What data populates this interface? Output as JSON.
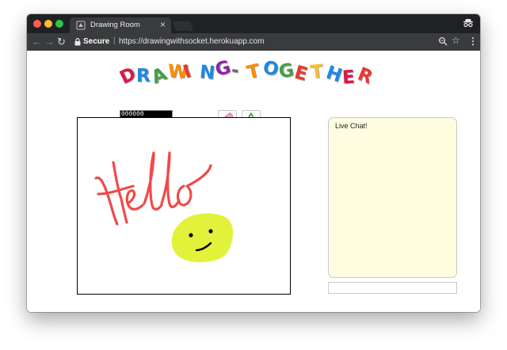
{
  "browser": {
    "tab_title": "Drawing Room",
    "tab_close": "×",
    "address_secure_label": "Secure",
    "address_separator": "|",
    "address_url": "https://drawingwithsocket.herokuapp.com",
    "back_glyph": "←",
    "forward_glyph": "→",
    "reload_glyph": "↻",
    "star_glyph": "☆",
    "menu_glyph": "⋮"
  },
  "page": {
    "logo_letters": [
      {
        "char": "D",
        "color": "#d81b4a"
      },
      {
        "char": "R",
        "color": "#1e88e5"
      },
      {
        "char": "A",
        "color": "#43a047"
      },
      {
        "char": "W",
        "color": "#fb8c00"
      },
      {
        "char": "I",
        "color": "#e53935"
      },
      {
        "char": "N",
        "color": "#1e88e5"
      },
      {
        "char": "G",
        "color": "#8e24aa"
      },
      {
        "char": "-",
        "color": "#6d6d6d"
      },
      {
        "char": "T",
        "color": "#fb8c00"
      },
      {
        "char": "O",
        "color": "#1e88e5"
      },
      {
        "char": "G",
        "color": "#43a047"
      },
      {
        "char": "E",
        "color": "#e53935"
      },
      {
        "char": "T",
        "color": "#fbc02d"
      },
      {
        "char": "H",
        "color": "#1e88e5"
      },
      {
        "char": "E",
        "color": "#d81b4a"
      },
      {
        "char": "R",
        "color": "#e53935"
      }
    ],
    "color_value": "000000",
    "brush_size_fraction": 0.3,
    "eraser_icon": "eraser-icon",
    "clear_icon": "recycle-icon",
    "chat_title": "Live Chat!",
    "chat_input_value": "",
    "stroke_colors": {
      "hello": "#f04a4a",
      "smiley_fill": "#e2f23a",
      "smiley_features": "#000000"
    }
  }
}
